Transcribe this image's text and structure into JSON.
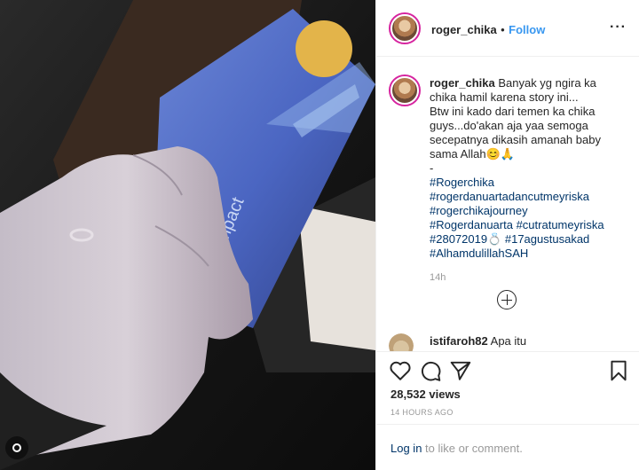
{
  "header": {
    "username": "roger_chika",
    "separator": "•",
    "follow_label": "Follow",
    "more_label": "···"
  },
  "caption": {
    "username": "roger_chika",
    "lines": [
      "Banyak yg ngira ka",
      "chika hamil karena story ini...",
      "Btw ini kado dari temen ka chika",
      "guys...do'akan aja yaa semoga",
      "secepatnya dikasih amanah baby",
      "sama Allah😊🙏",
      "-"
    ],
    "hashtags": [
      "#Rogerchika",
      "#rogerdanuartadancutmeyriska",
      "#rogerchikajourney",
      "#Rogerdanuarta #cutratumeyriska",
      "#28072019💍 #17agustusakad",
      "#AlhamdulillahSAH"
    ],
    "age": "14h"
  },
  "next_comment": {
    "username": "istifaroh82",
    "text": "Apa itu"
  },
  "media": {
    "package_text": "Compact"
  },
  "actions": {
    "icons": [
      "heart-icon",
      "comment-icon",
      "share-icon",
      "bookmark-icon"
    ]
  },
  "stats": {
    "views": "28,532 views",
    "timestamp": "14 HOURS AGO"
  },
  "footer": {
    "login_label": "Log in",
    "rest": " to like or comment."
  },
  "colors": {
    "link": "#3897f0",
    "hashtag": "#003569",
    "muted": "#999999",
    "avatar_ring": "#d6249f"
  }
}
